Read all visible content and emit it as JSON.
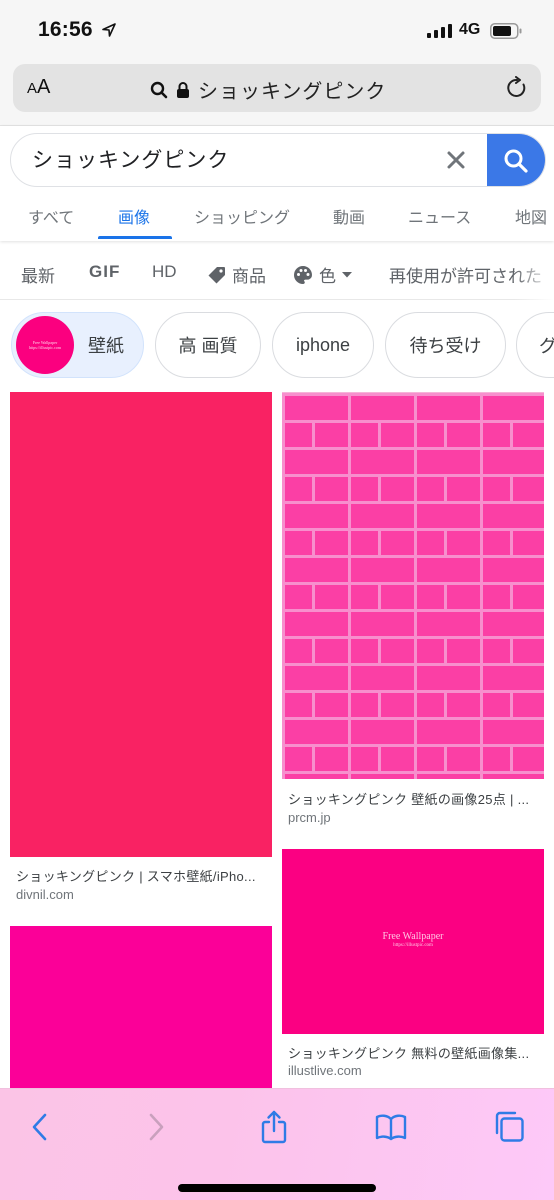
{
  "status_bar": {
    "time": "16:56",
    "network": "4G"
  },
  "safari": {
    "aa_label_small": "A",
    "aa_label_large": "A",
    "url_text": "ショッキングピンク"
  },
  "search": {
    "query": "ショッキングピンク",
    "placeholder": ""
  },
  "tabs": [
    {
      "label": "すべて",
      "active": false
    },
    {
      "label": "画像",
      "active": true
    },
    {
      "label": "ショッピング",
      "active": false
    },
    {
      "label": "動画",
      "active": false
    },
    {
      "label": "ニュース",
      "active": false
    },
    {
      "label": "地図",
      "active": false
    }
  ],
  "filters": [
    {
      "label": "最新"
    },
    {
      "label": "GIF"
    },
    {
      "label": "HD"
    },
    {
      "label": "商品",
      "icon": "tag-icon"
    },
    {
      "label": "色",
      "icon": "palette-icon",
      "dropdown": true
    },
    {
      "label": "再使用が許可された"
    }
  ],
  "chips": [
    {
      "label": "壁紙",
      "selected": true,
      "thumb_text": [
        "Free Wallpaper",
        "https://illustpic.com"
      ]
    },
    {
      "label": "高 画質",
      "selected": false
    },
    {
      "label": "iphone",
      "selected": false
    },
    {
      "label": "待ち受け",
      "selected": false
    },
    {
      "label": "グ",
      "selected": false
    }
  ],
  "results": [
    {
      "title": "ショッキングピンク | スマホ壁紙/iPho...",
      "source": "divnil.com",
      "color": "#f92263"
    },
    {
      "title": "ショッキングピンク 壁紙の画像25点 | ...",
      "source": "prcm.jp",
      "color": "#fb3fa5"
    },
    {
      "title": "",
      "source": "",
      "color": "#fb0098"
    },
    {
      "title": "ショッキングピンク 無料の壁紙画像集...",
      "source": "illustlive.com",
      "color": "#fb0082",
      "overlay_text": [
        "Free Wallpaper",
        "https://illustpic.com"
      ]
    }
  ],
  "colors": {
    "accent_blue": "#1a73e8",
    "search_button": "#3b78e7",
    "safari_icon_blue": "#2f7be6"
  }
}
